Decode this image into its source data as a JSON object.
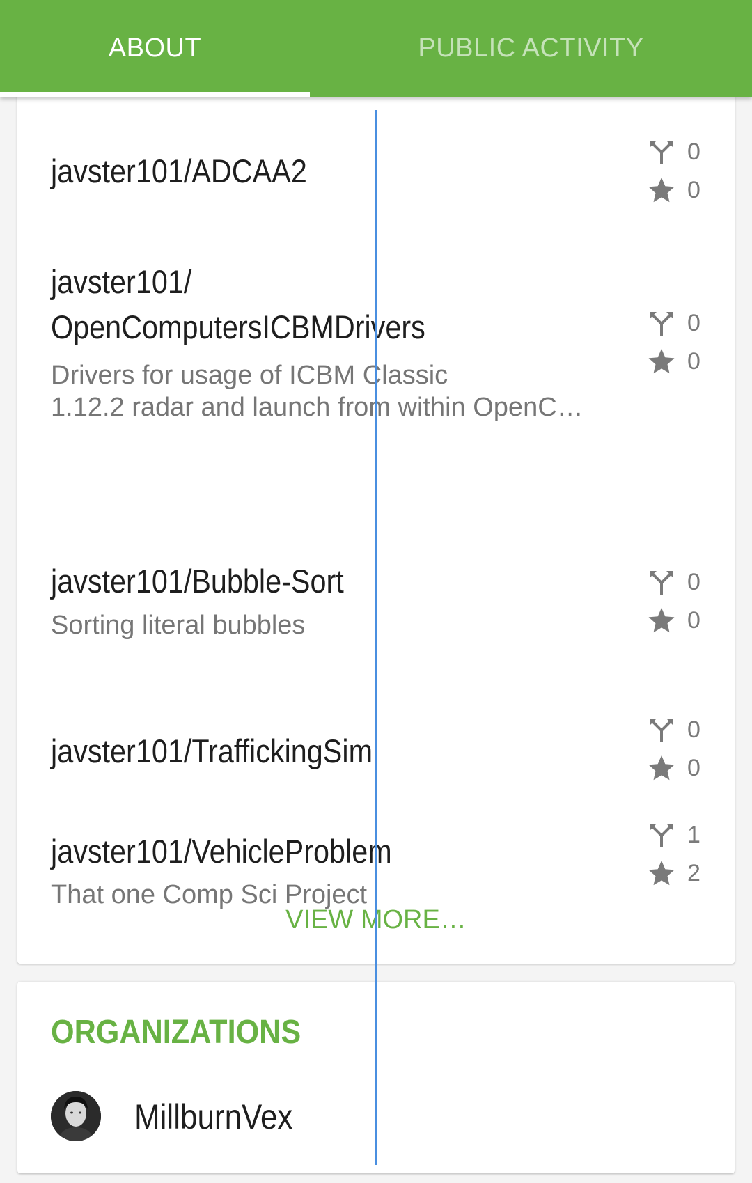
{
  "tabs": [
    {
      "label": "ABOUT",
      "selected": true
    },
    {
      "label": "PUBLIC ACTIVITY",
      "selected": false
    }
  ],
  "repositories": [
    {
      "name": "javster101/ADCAA2",
      "description": "",
      "forks": "0",
      "stars": "0"
    },
    {
      "name_line1": "javster101/",
      "name_line2": "OpenComputersICBMDrivers",
      "description": "Drivers for usage of ICBM Classic 1.12.2 radar and launch from within OpenC…",
      "description_line1": "Drivers for usage of ICBM Classic",
      "description_line2": "1.12.2 radar and launch from within OpenC…",
      "forks": "0",
      "stars": "0"
    },
    {
      "name": "javster101/Bubble-Sort",
      "description": "Sorting literal bubbles",
      "forks": "0",
      "stars": "0"
    },
    {
      "name": "javster101/TraffickingSim",
      "description": "",
      "forks": "0",
      "stars": "0"
    },
    {
      "name": "javster101/VehicleProblem",
      "description": "That one Comp Sci Project",
      "forks": "1",
      "stars": "2"
    }
  ],
  "view_more_label": "VIEW MORE…",
  "organizations": {
    "title": "ORGANIZATIONS",
    "items": [
      {
        "name": "MillburnVex"
      }
    ]
  },
  "colors": {
    "accent": "#68b244",
    "text_primary": "#1e1e1e",
    "text_secondary": "#767676",
    "guide_line": "#4a8fe0"
  },
  "icons": {
    "fork": "fork-icon",
    "star": "star-icon",
    "avatar": "avatar"
  }
}
